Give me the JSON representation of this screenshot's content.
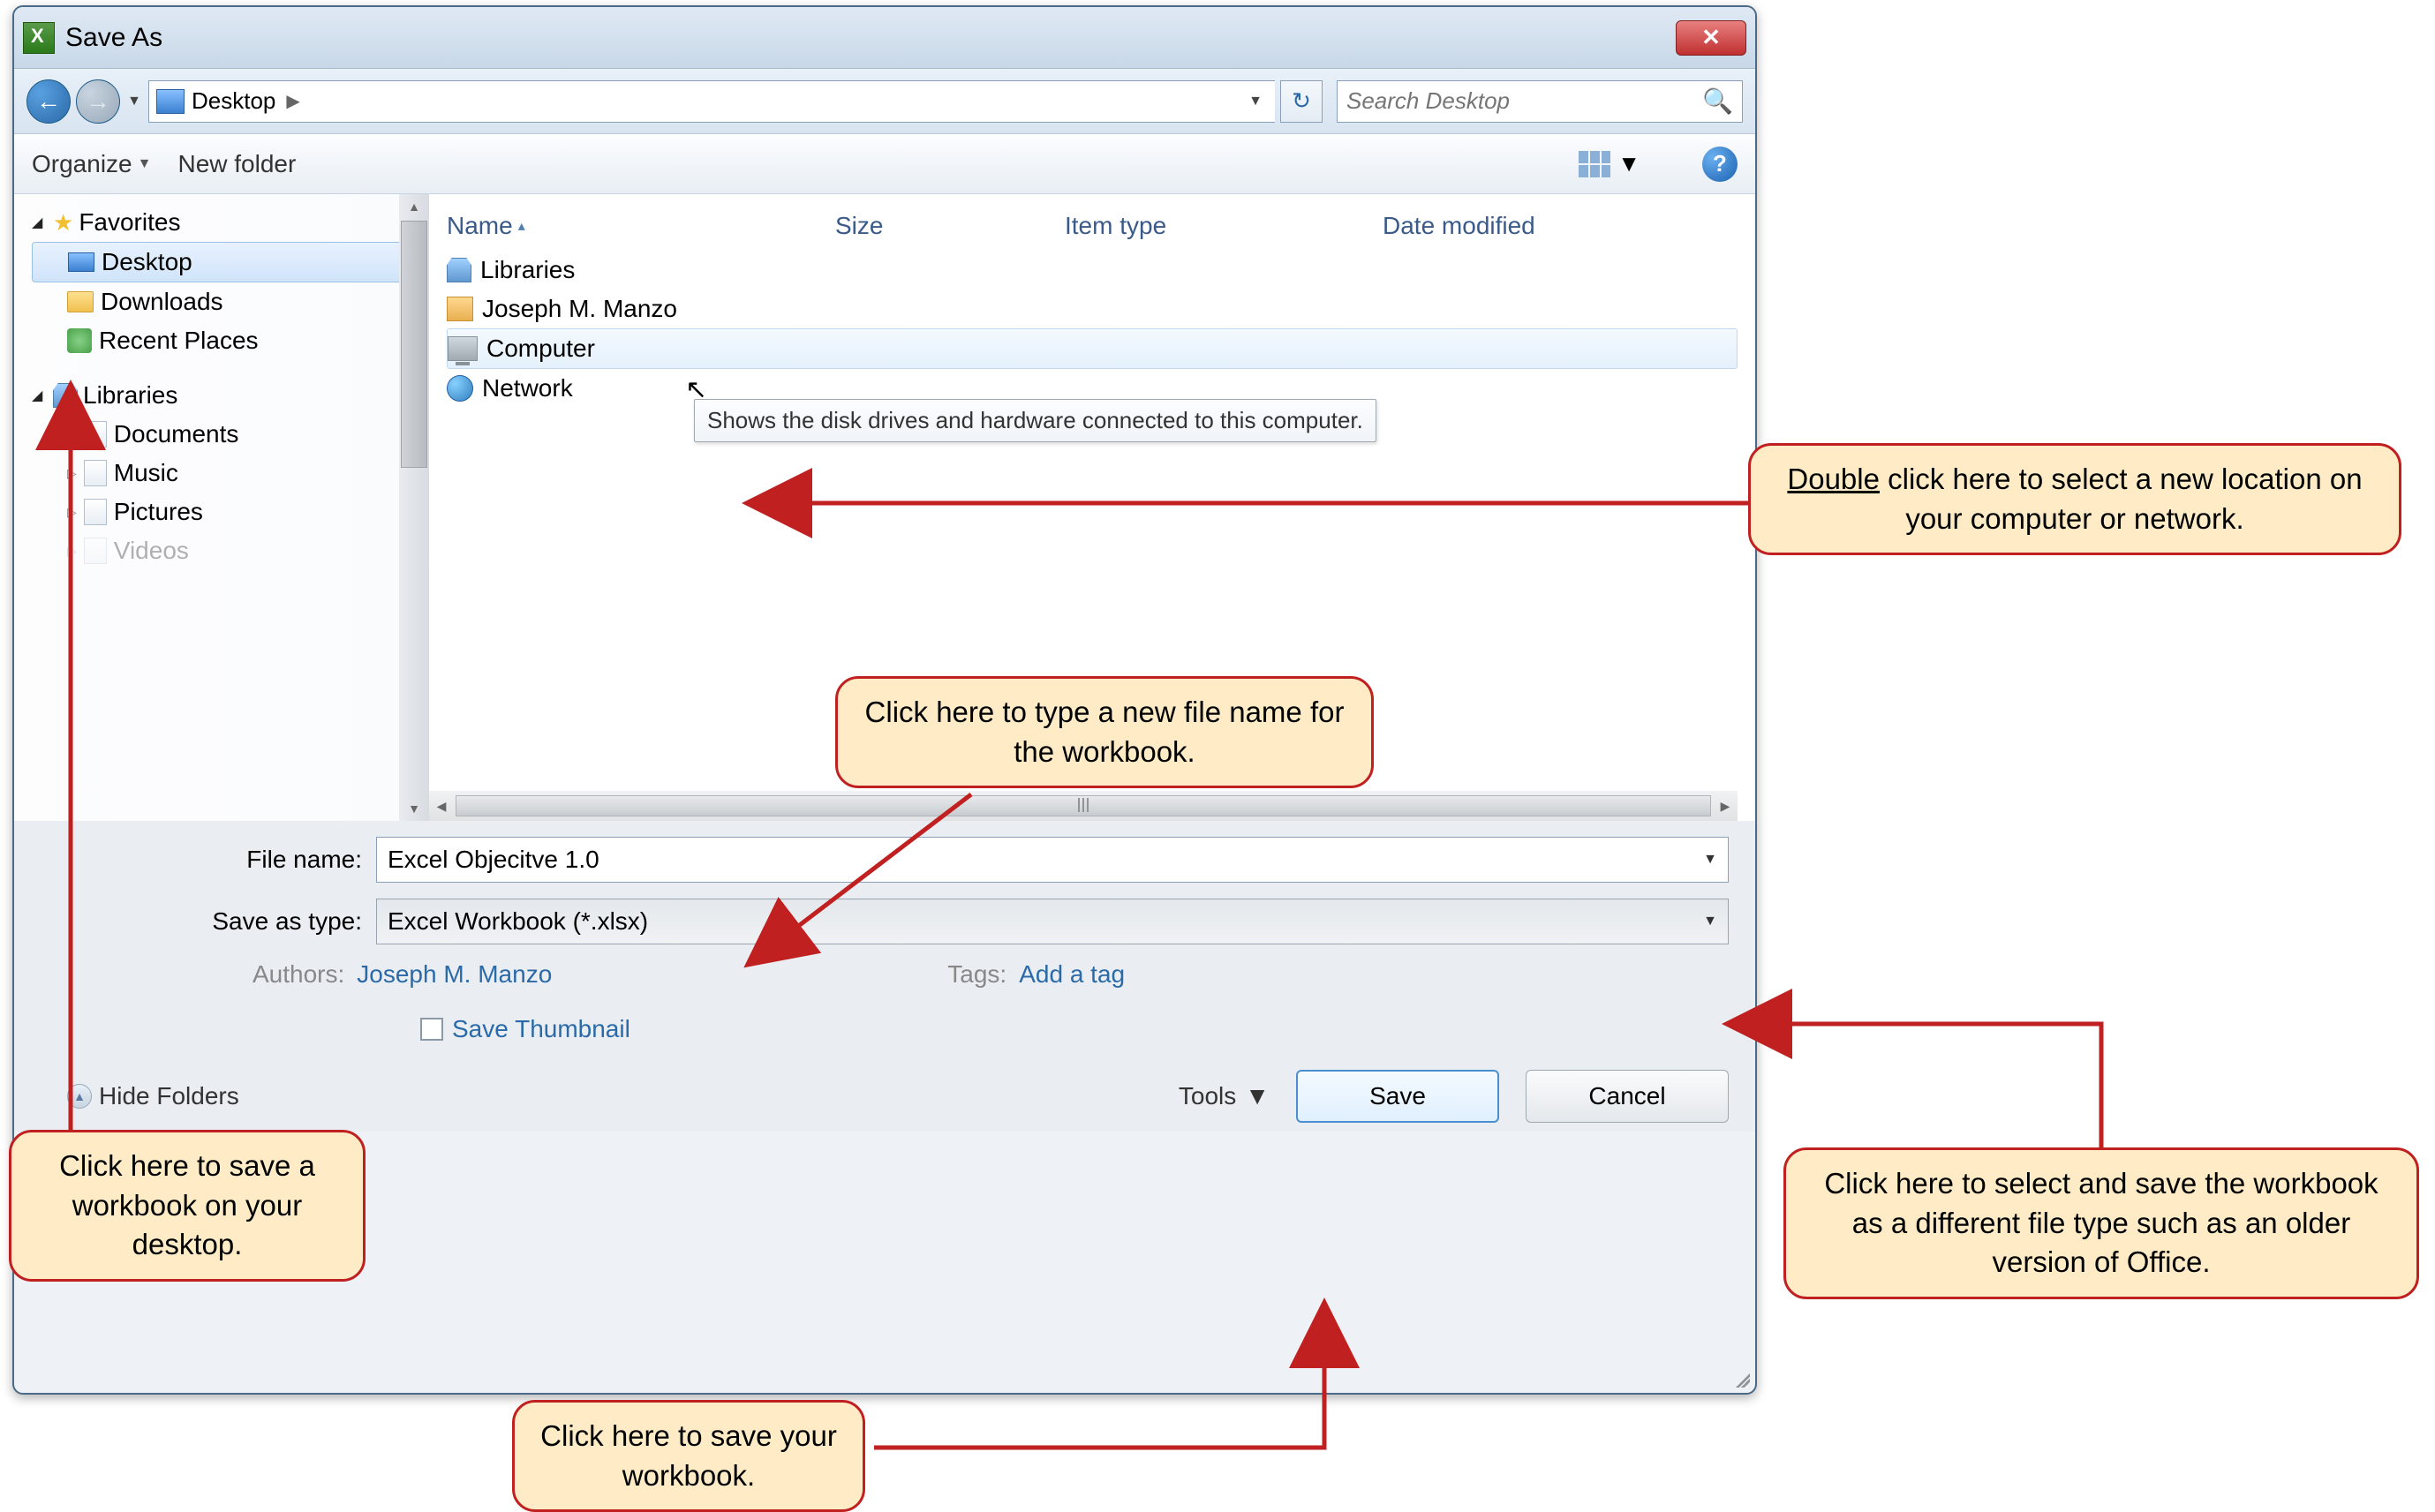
{
  "titlebar": {
    "title": "Save As",
    "close": "✕"
  },
  "navbar": {
    "back": "←",
    "forward": "→",
    "location": "Desktop",
    "refresh": "↻",
    "search_placeholder": "Search Desktop"
  },
  "toolbar": {
    "organize": "Organize",
    "new_folder": "New folder",
    "help": "?"
  },
  "sidebar": {
    "favorites": {
      "label": "Favorites",
      "items": [
        "Desktop",
        "Downloads",
        "Recent Places"
      ]
    },
    "libraries": {
      "label": "Libraries",
      "items": [
        "Documents",
        "Music",
        "Pictures",
        "Videos"
      ]
    }
  },
  "columns": {
    "name": "Name",
    "size": "Size",
    "item_type": "Item type",
    "date": "Date modified"
  },
  "files": [
    "Libraries",
    "Joseph M. Manzo",
    "Computer",
    "Network"
  ],
  "tooltip": "Shows the disk drives and hardware connected to this computer.",
  "form": {
    "filename_label": "File name:",
    "filename_value": "Excel Objecitve 1.0",
    "saveas_label": "Save as type:",
    "saveas_value": "Excel Workbook (*.xlsx)",
    "authors_label": "Authors:",
    "authors_value": "Joseph M. Manzo",
    "tags_label": "Tags:",
    "tags_value": "Add a tag",
    "save_thumbnail": "Save Thumbnail",
    "hide_folders": "Hide Folders",
    "tools": "Tools",
    "save": "Save",
    "cancel": "Cancel"
  },
  "callouts": {
    "c1_prefix": "Double",
    "c1_rest": " click here to select a new location on your computer or network.",
    "c2": "Click here to type a new file name for the workbook.",
    "c3": "Click here to save a workbook on your desktop.",
    "c4": "Click here to select and save the workbook as a different file type such as an older version of Office.",
    "c5": "Click here to save your workbook."
  }
}
